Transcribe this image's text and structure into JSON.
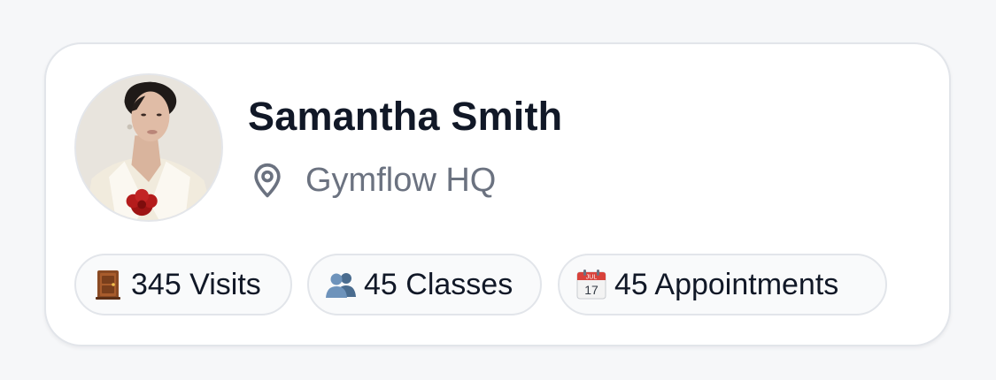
{
  "profile": {
    "name": "Samantha Smith",
    "location": "Gymflow HQ",
    "location_icon": "map-pin-icon",
    "avatar": "profile-photo"
  },
  "stats": [
    {
      "icon": "door-icon",
      "label": "345 Visits"
    },
    {
      "icon": "people-icon",
      "label": "45 Classes"
    },
    {
      "icon": "calendar-icon",
      "label": "45 Appointments",
      "icon_text_month": "JUL",
      "icon_text_day": "17"
    }
  ],
  "colors": {
    "page_background": "#f6f7f9",
    "card_background": "#ffffff",
    "card_border": "#e2e5ea",
    "name_text": "#111827",
    "location_text": "#6b7280",
    "pill_background": "#f9fafb",
    "pill_text": "#111827"
  }
}
